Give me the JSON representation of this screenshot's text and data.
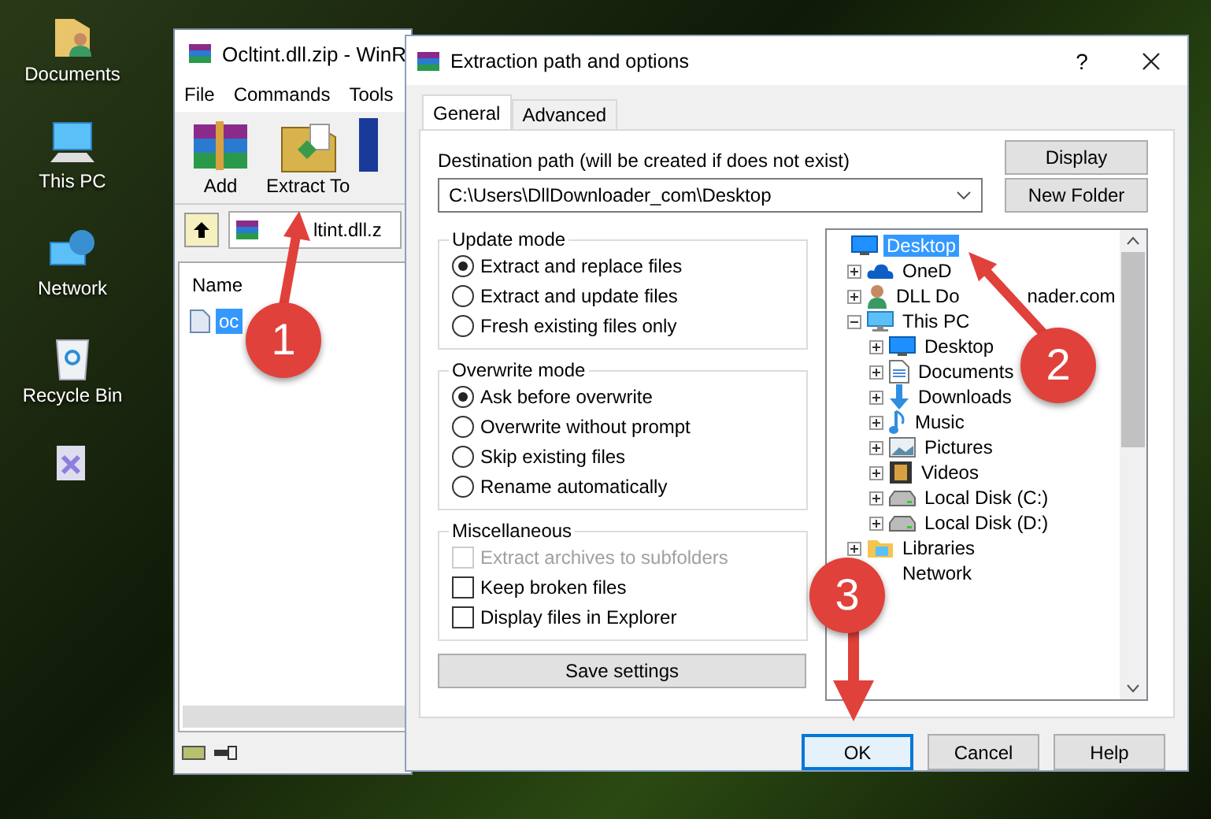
{
  "desktop": {
    "icons": [
      {
        "kind": "documents",
        "label": "Documents"
      },
      {
        "kind": "pc",
        "label": "This PC"
      },
      {
        "kind": "network",
        "label": "Network"
      },
      {
        "kind": "recycle",
        "label": "Recycle Bin"
      },
      {
        "kind": "shortcut"
      }
    ]
  },
  "winrar": {
    "title": "Ocltint.dll.zip - WinR",
    "menu": [
      "File",
      "Commands",
      "Tools"
    ],
    "toolbar": [
      {
        "kind": "add",
        "label": "Add"
      },
      {
        "kind": "extract",
        "label": "Extract To"
      }
    ],
    "address": "ltint.dll.z",
    "columns": [
      "Name"
    ],
    "files": [
      {
        "name": "oc",
        "selected": true
      }
    ]
  },
  "dialog": {
    "title": "Extraction path and options",
    "help": "?",
    "tabs": [
      {
        "label": "General",
        "selected": true
      },
      {
        "label": "Advanced",
        "selected": false
      }
    ],
    "destination_label": "Destination path (will be created if does not exist)",
    "destination_path": "C:\\Users\\DllDownloader_com\\Desktop",
    "side_buttons": [
      "Display",
      "New Folder"
    ],
    "update_mode": {
      "title": "Update mode",
      "options": [
        {
          "label": "Extract and replace files",
          "selected": true
        },
        {
          "label": "Extract and update files",
          "selected": false
        },
        {
          "label": "Fresh existing files only",
          "selected": false
        }
      ]
    },
    "overwrite_mode": {
      "title": "Overwrite mode",
      "options": [
        {
          "label": "Ask before overwrite",
          "selected": true
        },
        {
          "label": "Overwrite without prompt",
          "selected": false
        },
        {
          "label": "Skip existing files",
          "selected": false
        },
        {
          "label": "Rename automatically",
          "selected": false
        }
      ]
    },
    "miscellaneous": {
      "title": "Miscellaneous",
      "options": [
        {
          "label": "Extract archives to subfolders",
          "checked": false,
          "disabled": true
        },
        {
          "label": "Keep broken files",
          "checked": false,
          "disabled": false
        },
        {
          "label": "Display files in Explorer",
          "checked": false,
          "disabled": false
        }
      ]
    },
    "save_button": "Save settings",
    "tree": [
      {
        "kind": "desktop",
        "label": "Desktop",
        "selected": true,
        "children": [
          {
            "kind": "cloud",
            "label": "OneD",
            "selected": false,
            "expanded": false
          },
          {
            "kind": "user",
            "label": "DLL Do",
            "label_tail": "nader.com",
            "selected": false,
            "expanded": false
          },
          {
            "kind": "pc",
            "label": "This PC",
            "selected": false,
            "expanded": true,
            "children": [
              {
                "kind": "desktop",
                "label": "Desktop",
                "selected": false,
                "expanded": false
              },
              {
                "kind": "docs",
                "label": "Documents",
                "selected": false,
                "expanded": false
              },
              {
                "kind": "download",
                "label": "Downloads",
                "selected": false,
                "expanded": false
              },
              {
                "kind": "music",
                "label": "Music",
                "selected": false,
                "expanded": false
              },
              {
                "kind": "pictures",
                "label": "Pictures",
                "selected": false,
                "expanded": false
              },
              {
                "kind": "videos",
                "label": "Videos",
                "selected": false,
                "expanded": false
              },
              {
                "kind": "disk",
                "label": "Local Disk (C:)",
                "selected": false,
                "expanded": false
              },
              {
                "kind": "disk",
                "label": "Local Disk (D:)",
                "selected": false,
                "expanded": false
              }
            ]
          },
          {
            "kind": "libraries",
            "label": "Libraries",
            "selected": false,
            "expanded": false
          },
          {
            "label": "Network",
            "selected": false
          }
        ]
      }
    ],
    "footer_buttons": [
      {
        "label": "OK",
        "default": true
      },
      {
        "label": "Cancel",
        "default": false
      },
      {
        "label": "Help",
        "default": false
      }
    ]
  },
  "callouts": [
    {
      "number": "1"
    },
    {
      "number": "2"
    },
    {
      "number": "3"
    }
  ]
}
